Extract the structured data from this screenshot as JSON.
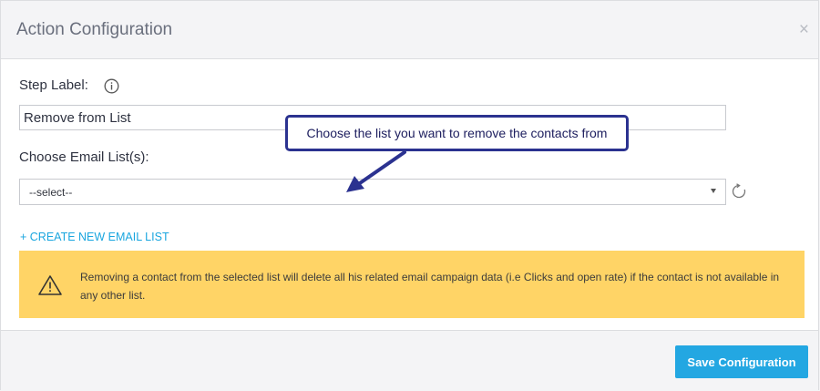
{
  "modal": {
    "title": "Action Configuration",
    "close_glyph": "×"
  },
  "form": {
    "step_label": {
      "label": "Step Label:",
      "value": "Remove from List",
      "info_icon": "info-icon"
    },
    "email_list": {
      "label": "Choose Email List(s):",
      "selected": "--select--",
      "refresh_icon": "refresh-icon"
    },
    "create_link": "+ CREATE NEW EMAIL LIST"
  },
  "warning": {
    "icon": "warning-triangle-icon",
    "text": "Removing a contact from the selected list will delete all his related email campaign data (i.e Clicks and open rate) if the contact is not available in any other list."
  },
  "callout": {
    "text": "Choose the list you want to remove the contacts from"
  },
  "footer": {
    "save_label": "Save Configuration"
  },
  "colors": {
    "accent": "#23a7e2",
    "link": "#1aa6df",
    "warning_bg": "#ffd466",
    "callout_border": "#2b3290"
  }
}
